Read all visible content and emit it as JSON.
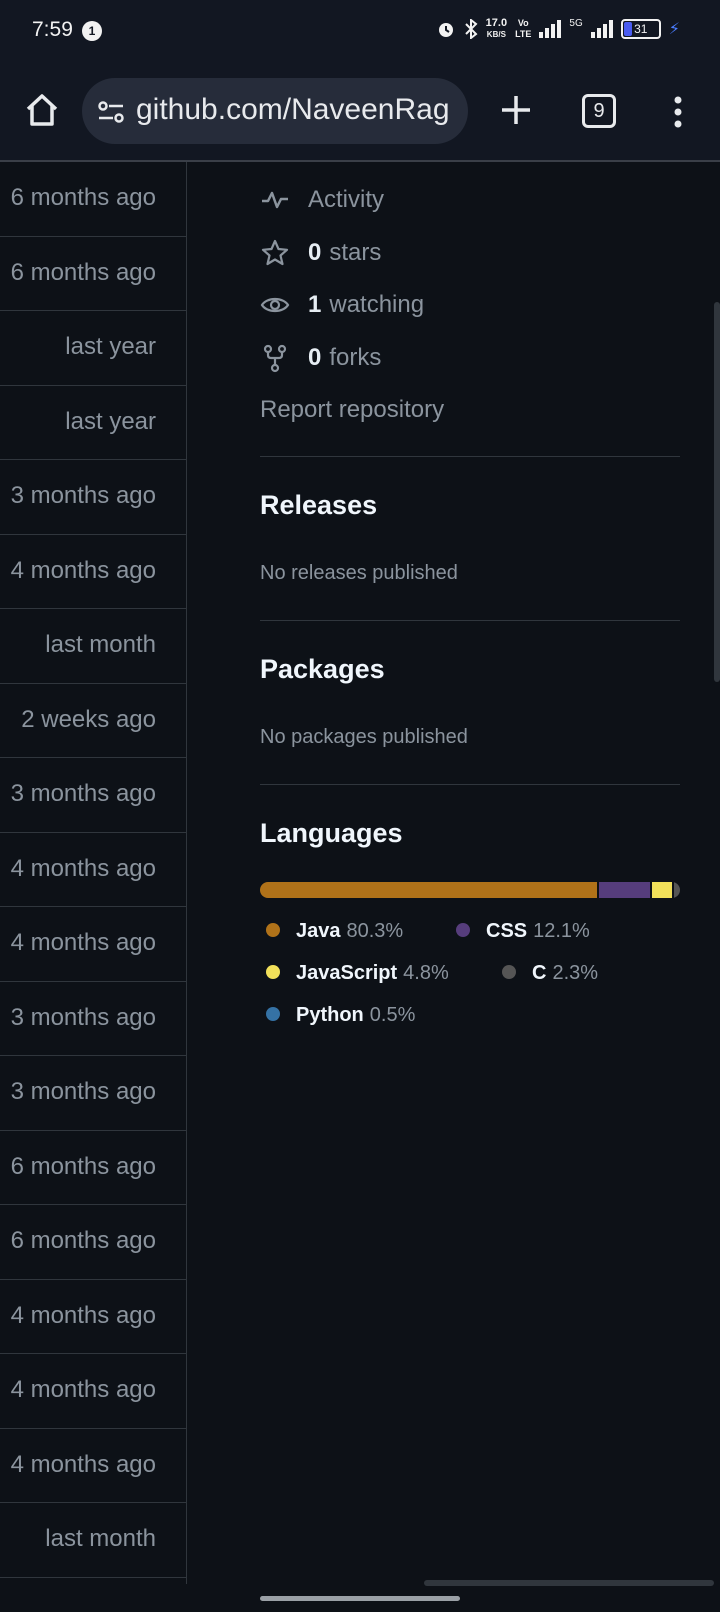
{
  "status_bar": {
    "time": "7:59",
    "notification_count": "1",
    "net_speed_value": "17.0",
    "net_speed_unit": "KB/S",
    "volte_top": "Vo",
    "volte_mid": "LTE",
    "network": "5G",
    "battery": "31"
  },
  "browser": {
    "url": "github.com/NaveenRag",
    "tab_count": "9"
  },
  "file_list": {
    "updated": [
      "6 months ago",
      "6 months ago",
      "last year",
      "last year",
      "3 months ago",
      "4 months ago",
      "last month",
      "2 weeks ago",
      "3 months ago",
      "4 months ago",
      "4 months ago",
      "3 months ago",
      "3 months ago",
      "6 months ago",
      "6 months ago",
      "4 months ago",
      "4 months ago",
      "4 months ago",
      "last month"
    ]
  },
  "about": {
    "activity_label": "Activity",
    "stars_count": "0",
    "stars_label": "stars",
    "watching_count": "1",
    "watching_label": "watching",
    "forks_count": "0",
    "forks_label": "forks",
    "report_label": "Report repository"
  },
  "releases": {
    "title": "Releases",
    "empty_text": "No releases published"
  },
  "packages": {
    "title": "Packages",
    "empty_text": "No packages published"
  },
  "languages": {
    "title": "Languages",
    "items": [
      {
        "name": "Java",
        "percent": "80.3%",
        "value": 80.3,
        "color": "#b07219"
      },
      {
        "name": "CSS",
        "percent": "12.1%",
        "value": 12.1,
        "color": "#563d7c"
      },
      {
        "name": "JavaScript",
        "percent": "4.8%",
        "value": 4.8,
        "color": "#f1e05a"
      },
      {
        "name": "C",
        "percent": "2.3%",
        "value": 2.3,
        "color": "#555555"
      },
      {
        "name": "Python",
        "percent": "0.5%",
        "value": 0.5,
        "color": "#3572a5"
      }
    ]
  }
}
